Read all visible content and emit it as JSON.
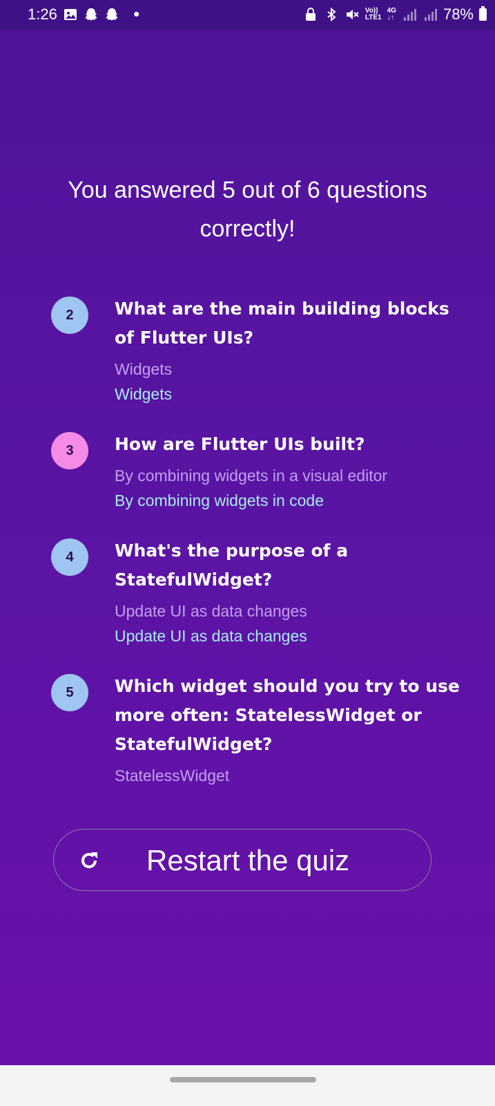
{
  "status_bar": {
    "time": "1:26",
    "battery": "78%",
    "network_top": "Vo))",
    "network_bottom": "LTE1",
    "network_type": "4G",
    "icons": [
      "image-icon",
      "snapchat-icon",
      "snapchat-icon",
      "dot-icon",
      "lock-icon",
      "bluetooth-icon",
      "mute-icon",
      "signal-icon",
      "signal-icon",
      "battery-icon"
    ]
  },
  "summary": {
    "title": "You answered 5 out of 6 questions correctly!"
  },
  "answers": [
    {
      "index": "2",
      "question": "What are the main building blocks of Flutter UIs?",
      "user_answer": "Widgets",
      "correct_answer": "Widgets",
      "is_correct": true
    },
    {
      "index": "3",
      "question": "How are Flutter UIs built?",
      "user_answer": "By combining widgets in a visual editor",
      "correct_answer": "By combining widgets in code",
      "is_correct": false
    },
    {
      "index": "4",
      "question": "What's the purpose of a StatefulWidget?",
      "user_answer": "Update UI as data changes",
      "correct_answer": "Update UI as data changes",
      "is_correct": true
    },
    {
      "index": "5",
      "question": "Which widget should you try to use more often: StatelessWidget or StatefulWidget?",
      "user_answer": "StatelessWidget",
      "is_correct": true
    }
  ],
  "restart": {
    "label": "Restart the quiz",
    "icon": "refresh-icon"
  },
  "colors": {
    "background_top": "#4f139a",
    "background_bottom": "#6a10ab",
    "badge_correct": "#9fc6f2",
    "badge_wrong": "#f58be6",
    "user_answer_text": "#c69ff2",
    "correct_answer_text": "#a8ecf0"
  }
}
